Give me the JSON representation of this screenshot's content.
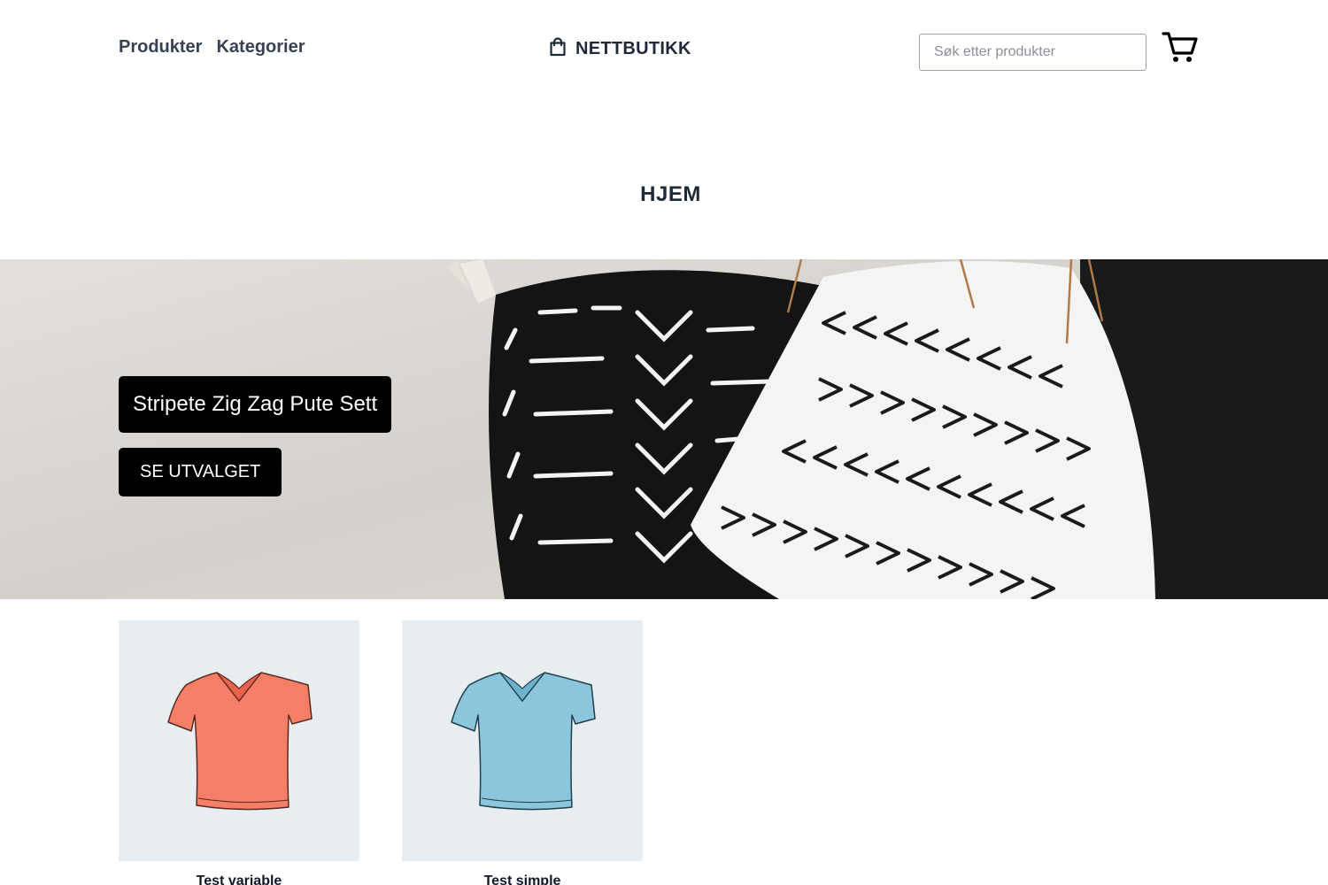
{
  "header": {
    "nav": [
      {
        "label": "Produkter"
      },
      {
        "label": "Kategorier"
      }
    ],
    "brand": "NETTBUTIKK",
    "search_placeholder": "Søk etter produkter",
    "icons": {
      "brand": "shopping-bag-icon",
      "cart": "cart-icon"
    }
  },
  "page": {
    "title": "HJEM"
  },
  "hero": {
    "title": "Stripete Zig Zag Pute Sett",
    "button_label": "SE UTVALGET"
  },
  "products": [
    {
      "name": "Test variable",
      "color": "#f47e66"
    },
    {
      "name": "Test simple",
      "color": "#8cc6dc"
    }
  ],
  "colors": {
    "text": "#374151",
    "button_bg": "#000000",
    "card_bg": "#e8edf2"
  }
}
